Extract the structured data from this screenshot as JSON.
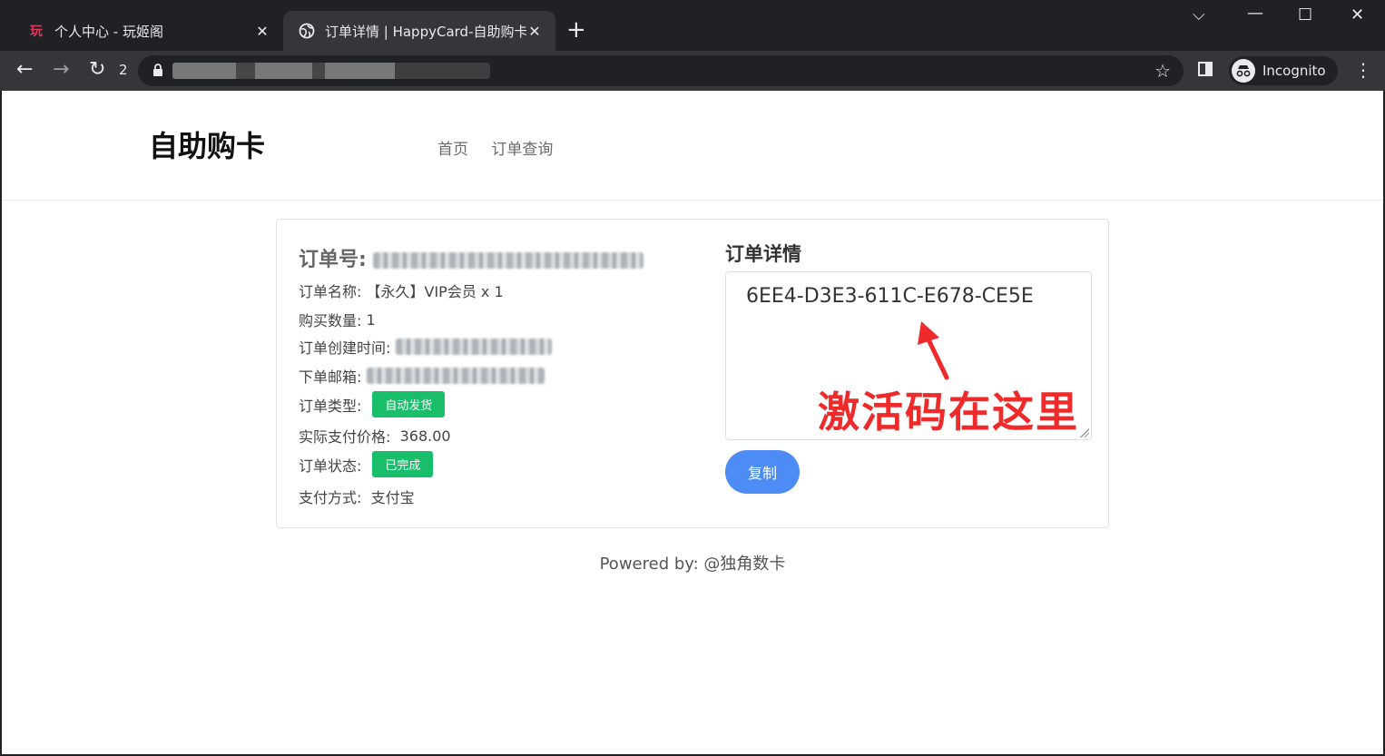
{
  "browser": {
    "tabs": [
      {
        "favicon_text": "玩",
        "title": "个人中心 - 玩姬阁",
        "active": false
      },
      {
        "title": "订单详情 | HappyCard-自助购卡",
        "active": true
      }
    ],
    "reload_badge": "2",
    "incognito_label": "Incognito",
    "icons": {
      "back": "arrow-left-icon",
      "forward": "arrow-right-icon",
      "reload": "reload-icon",
      "star": "star-icon",
      "side_panel": "side-panel-icon",
      "menu": "kebab-menu-icon"
    }
  },
  "site": {
    "brand": "自助购卡",
    "nav": [
      "首页",
      "订单查询"
    ]
  },
  "order": {
    "number_label": "订单号:",
    "rows": {
      "name_label": "订单名称:",
      "name_value": "【永久】VIP会员 x 1",
      "qty_label": "购买数量:",
      "qty_value": "1",
      "created_label": "订单创建时间:",
      "email_label": "下单邮箱:",
      "type_label": "订单类型:",
      "type_badge": "自动发货",
      "price_label": "实际支付价格:",
      "price_value": "368.00",
      "status_label": "订单状态:",
      "status_badge": "已完成",
      "pay_label": "支付方式:",
      "pay_value": "支付宝"
    },
    "detail_title": "订单详情",
    "activation_code": "6EE4-D3E3-611C-E678-CE5E",
    "copy_button": "复制",
    "annotation": "激活码在这里"
  },
  "footer": "Powered by: @独角数卡",
  "colors": {
    "badge_green": "#19be6b",
    "copy_blue": "#4d8cf5",
    "annotation_red": "#ee2a2a"
  }
}
